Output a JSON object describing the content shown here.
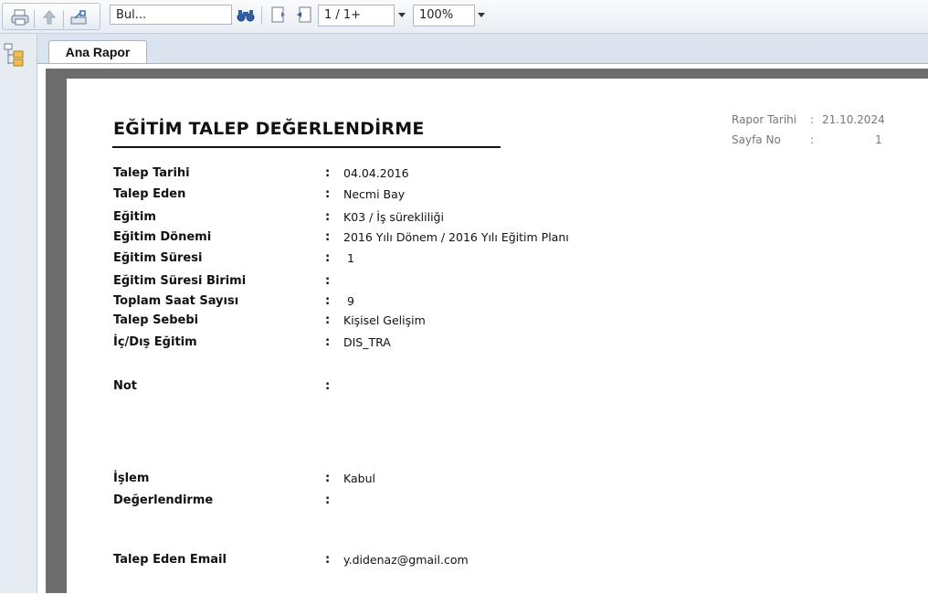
{
  "toolbar": {
    "find_placeholder": "Bul...",
    "page_value": "1 / 1+",
    "zoom_value": "100%"
  },
  "tabs": [
    {
      "label": "Ana Rapor"
    }
  ],
  "report": {
    "title": "EĞİTİM TALEP DEĞERLENDİRME",
    "meta": {
      "report_date_label": "Rapor Tarihi",
      "report_date_colon": ":",
      "report_date_value": "21.10.2024",
      "page_label": "Sayfa No",
      "page_colon": ":",
      "page_value": "1"
    },
    "fields": [
      {
        "label": "Talep Tarihi",
        "colon": ":",
        "value": "04.04.2016"
      },
      {
        "label": "Talep Eden",
        "colon": ":",
        "value": "Necmi Bay"
      },
      {
        "label": "Eğitim",
        "colon": ":",
        "value": "K03 / İş sürekliliği"
      },
      {
        "label": "Eğitim Dönemi",
        "colon": ":",
        "value": "2016 Yılı Dönem / 2016 Yılı Eğitim Planı"
      },
      {
        "label": "Eğitim Süresi",
        "colon": ":",
        "value": "1"
      },
      {
        "label": "Eğitim Süresi Birimi",
        "colon": ":",
        "value": ""
      },
      {
        "label": "Toplam Saat Sayısı",
        "colon": ":",
        "value": "9"
      },
      {
        "label": "Talep Sebebi",
        "colon": ":",
        "value": "Kişisel Gelişim"
      },
      {
        "label": "İç/Dış Eğitim",
        "colon": ":",
        "value": "DIS_TRA"
      },
      {
        "label": "Not",
        "colon": ":",
        "value": ""
      },
      {
        "label": "İşlem",
        "colon": ":",
        "value": "Kabul"
      },
      {
        "label": "Değerlendirme",
        "colon": ":",
        "value": ""
      },
      {
        "label": "Talep Eden Email",
        "colon": ":",
        "value": "y.didenaz@gmail.com"
      }
    ]
  },
  "icons": {
    "print": "printer-icon",
    "export": "export-icon",
    "find": "binoculars-icon",
    "prev_page": "page-prev-icon",
    "next_page": "page-next-icon",
    "tree": "document-tree-icon"
  }
}
